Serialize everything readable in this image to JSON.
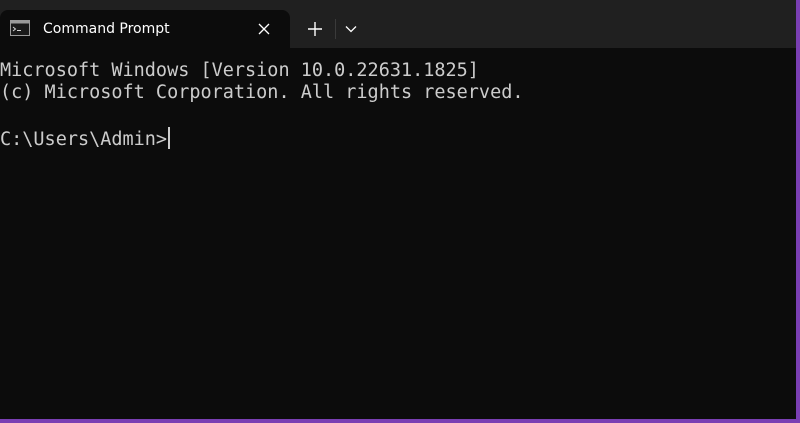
{
  "tab": {
    "title": "Command Prompt",
    "icon": "cmd-icon"
  },
  "titlebar": {
    "close_icon": "close-icon",
    "new_tab_icon": "plus-icon",
    "dropdown_icon": "chevron-down-icon"
  },
  "terminal": {
    "lines": [
      "Microsoft Windows [Version 10.0.22631.1825]",
      "(c) Microsoft Corporation. All rights reserved."
    ],
    "prompt": "C:\\Users\\Admin>"
  },
  "colors": {
    "window_border": "#7a3fb3",
    "titlebar_bg": "#202020",
    "terminal_bg": "#0c0c0c",
    "text": "#cccccc"
  }
}
